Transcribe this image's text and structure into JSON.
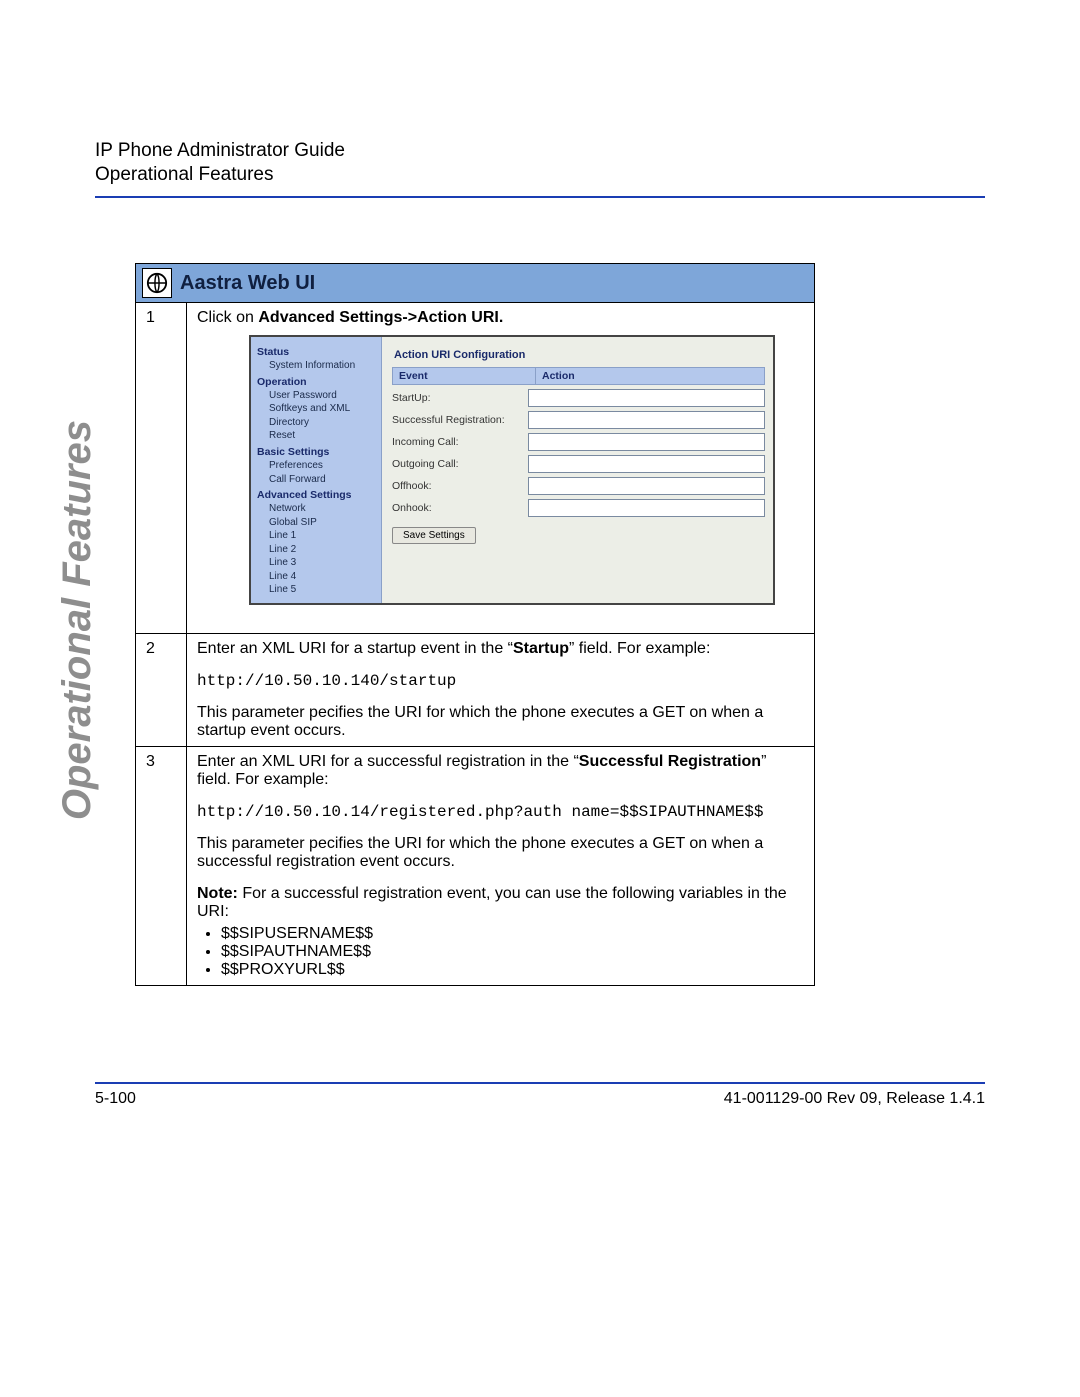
{
  "header": {
    "title": "IP Phone Administrator Guide",
    "section": "Operational Features"
  },
  "side_label": "Operational Features",
  "procedure": {
    "banner": "Aastra Web UI",
    "steps": {
      "s1": {
        "num": "1",
        "pre": "Click on ",
        "bold": "Advanced Settings->Action URI.",
        "post": ""
      },
      "s2": {
        "num": "2",
        "line1_pre": "Enter an XML URI for a startup event in the “",
        "line1_bold": "Startup",
        "line1_post": "” field. For example:",
        "code": "http://10.50.10.140/startup",
        "line2": "This parameter pecifies the URI for which the phone executes a GET on when a startup event occurs."
      },
      "s3": {
        "num": "3",
        "line1_pre": "Enter an XML URI for a successful registration in the “",
        "line1_bold": "Successful Registration",
        "line1_post": "” field. For example:",
        "code": "http://10.50.10.14/registered.php?auth name=$$SIPAUTHNAME$$",
        "line2": "This parameter pecifies the URI for which the phone executes a GET on when a successful registration event occurs.",
        "note_bold": "Note:",
        "note_text": " For a successful registration event, you can use the following variables in the URI:",
        "vars": {
          "v1": "$$SIPUSERNAME$$",
          "v2": "$$SIPAUTHNAME$$",
          "v3": "$$PROXYURL$$"
        }
      }
    }
  },
  "screenshot": {
    "menu": {
      "g1": "Status",
      "g1i1": "System Information",
      "g2": "Operation",
      "g2i1": "User Password",
      "g2i2": "Softkeys and XML",
      "g2i3": "Directory",
      "g2i4": "Reset",
      "g3": "Basic Settings",
      "g3i1": "Preferences",
      "g3i2": "Call Forward",
      "g4": "Advanced Settings",
      "g4i1": "Network",
      "g4i2": "Global SIP",
      "g4i3": "Line 1",
      "g4i4": "Line 2",
      "g4i5": "Line 3",
      "g4i6": "Line 4",
      "g4i7": "Line 5"
    },
    "panel": {
      "title": "Action URI Configuration",
      "col1": "Event",
      "col2": "Action",
      "r1": "StartUp:",
      "r2": "Successful Registration:",
      "r3": "Incoming Call:",
      "r4": "Outgoing Call:",
      "r5": "Offhook:",
      "r6": "Onhook:",
      "save": "Save Settings"
    }
  },
  "footer": {
    "left": "5-100",
    "right": "41-001129-00 Rev 09, Release 1.4.1"
  }
}
